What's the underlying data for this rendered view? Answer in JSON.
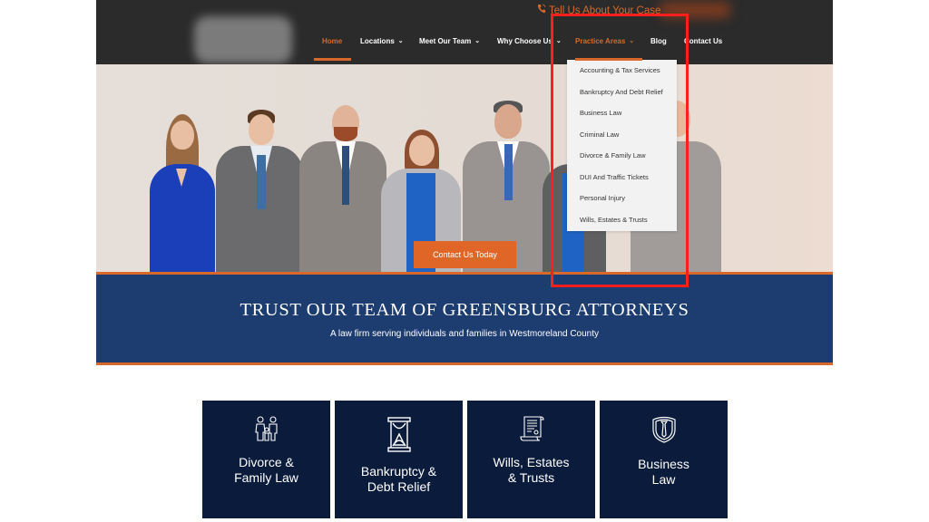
{
  "header": {
    "logo": "blurred-logo",
    "topline": "Tell Us About Your Case",
    "topline_icon": "phone-icon",
    "nav": [
      {
        "label": "Home",
        "active": true,
        "has_dropdown": false
      },
      {
        "label": "Locations",
        "active": false,
        "has_dropdown": true
      },
      {
        "label": "Meet Our Team",
        "active": false,
        "has_dropdown": true
      },
      {
        "label": "Why Choose Us",
        "active": false,
        "has_dropdown": true
      },
      {
        "label": "Practice Areas",
        "active": true,
        "has_dropdown": true
      },
      {
        "label": "Blog",
        "active": false,
        "has_dropdown": false
      },
      {
        "label": "Contact Us",
        "active": false,
        "has_dropdown": false
      }
    ],
    "chevron": "⌄"
  },
  "dropdown": {
    "items": [
      "Accounting & Tax Services",
      "Bankruptcy And Debt Relief",
      "Business Law",
      "Criminal Law",
      "Divorce & Family Law",
      "DUI And Traffic Tickets",
      "Personal Injury",
      "Wills, Estates & Trusts"
    ]
  },
  "hero": {
    "cta_label": "Contact Us Today"
  },
  "banner": {
    "title": "TRUST OUR TEAM OF GREENSBURG ATTORNEYS",
    "subtitle": "A law firm serving individuals and families in Westmoreland County"
  },
  "cards": [
    {
      "line1": "Divorce &",
      "line2": "Family Law",
      "icon": "family-icon"
    },
    {
      "line1": "Bankruptcy &",
      "line2": "Debt Relief",
      "icon": "hourglass-icon"
    },
    {
      "line1": "Wills, Estates",
      "line2": "& Trusts",
      "icon": "scroll-document-icon"
    },
    {
      "line1": "Business",
      "line2": "Law",
      "icon": "shield-tie-icon"
    }
  ],
  "colors": {
    "accent_orange": "#d8692a",
    "header_bg": "#2b2b2b",
    "banner_blue": "#1d3c70",
    "card_navy": "#0b1b3b",
    "annotation_red": "#ff1f1f"
  }
}
